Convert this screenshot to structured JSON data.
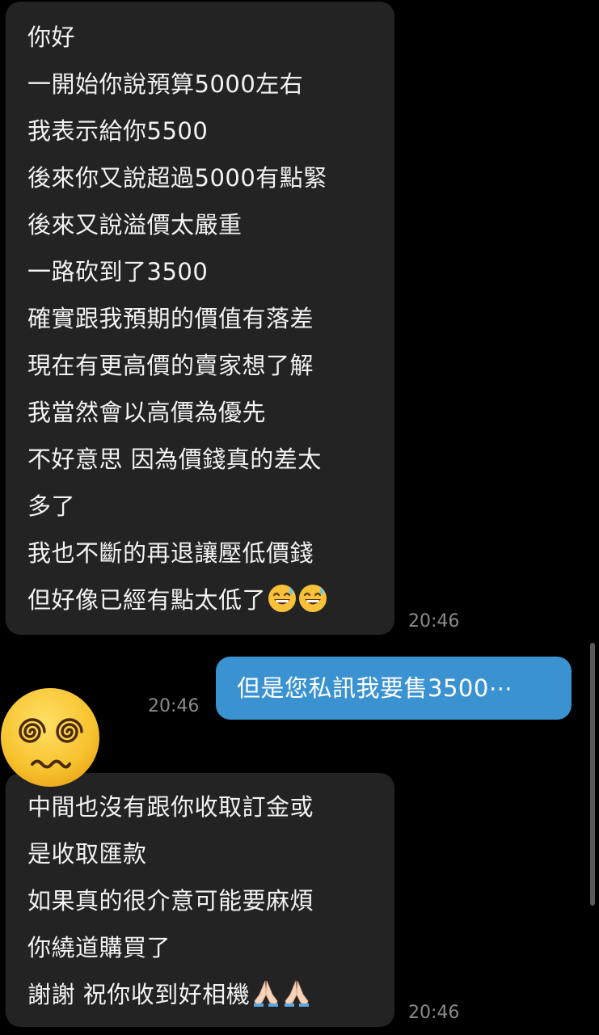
{
  "messages": {
    "incoming_1": {
      "lines": [
        "你好",
        "一開始你說預算5000左右",
        "我表示給你5500",
        "後來你又說超過5000有點緊",
        "後來又說溢價太嚴重",
        "一路砍到了3500",
        "確實跟我預期的價值有落差",
        "現在有更高價的賣家想了解",
        "我當然會以高價為優先",
        "不好意思 因為價錢真的差太",
        "多了",
        "我也不斷的再退讓壓低價錢",
        "但好像已經有點太低了"
      ],
      "trailing_emojis": [
        "grinning-sweat-emoji",
        "grinning-sweat-emoji"
      ],
      "time": "20:46"
    },
    "outgoing_1": {
      "text": "但是您私訊我要售3500⋯",
      "time": "20:46"
    },
    "incoming_2": {
      "lines": [
        "中間也沒有跟你收取訂金或",
        "是收取匯款",
        "如果真的很介意可能要麻煩",
        "你繞道購買了",
        "謝謝 祝你收到好相機"
      ],
      "trailing_emojis": [
        "folded-hands-emoji",
        "folded-hands-emoji"
      ],
      "time": "20:46"
    }
  },
  "avatar_icon": "dizzy-face-emoji",
  "colors": {
    "background": "#000000",
    "incoming_bubble": "#232323",
    "outgoing_bubble": "#3a93d0",
    "text": "#f2f2f2",
    "timestamp": "#8a8a8a"
  }
}
